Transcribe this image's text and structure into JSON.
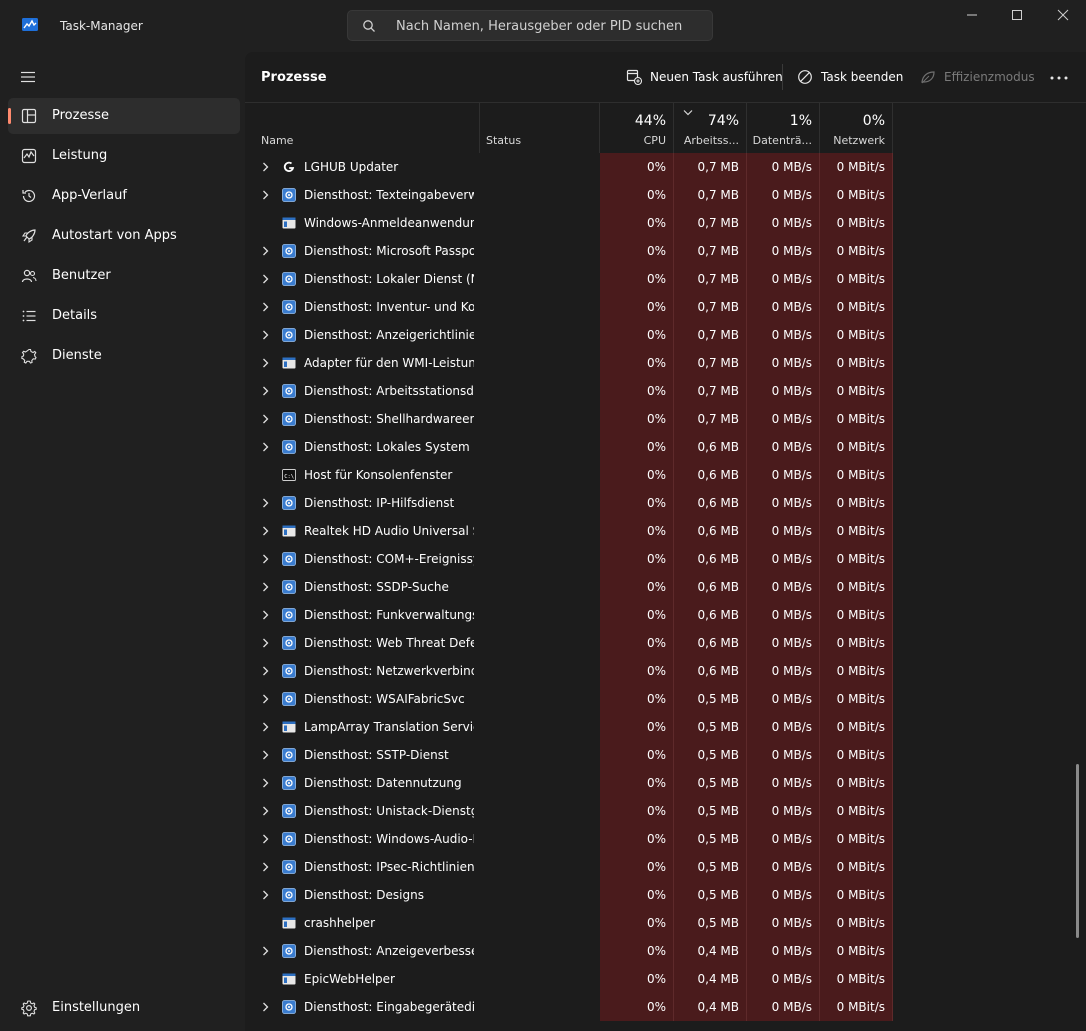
{
  "window": {
    "title": "Task-Manager",
    "search_placeholder": "Nach Namen, Herausgeber oder PID suchen"
  },
  "sidebar": {
    "items": [
      {
        "label": "Prozesse",
        "icon": "processes-icon",
        "active": true
      },
      {
        "label": "Leistung",
        "icon": "performance-icon"
      },
      {
        "label": "App-Verlauf",
        "icon": "history-icon"
      },
      {
        "label": "Autostart von Apps",
        "icon": "startup-icon"
      },
      {
        "label": "Benutzer",
        "icon": "users-icon"
      },
      {
        "label": "Details",
        "icon": "details-icon"
      },
      {
        "label": "Dienste",
        "icon": "services-icon"
      }
    ],
    "settings_label": "Einstellungen"
  },
  "toolbar": {
    "page_title": "Prozesse",
    "new_task_label": "Neuen Task ausführen",
    "end_task_label": "Task beenden",
    "efficiency_label": "Effizienzmodus"
  },
  "columns": {
    "name": "Name",
    "status": "Status",
    "cpu": {
      "label": "CPU",
      "percent": "44%"
    },
    "memory": {
      "label": "Arbeitss...",
      "percent": "74%"
    },
    "disk": {
      "label": "Datenträ...",
      "percent": "1%"
    },
    "network": {
      "label": "Netzwerk",
      "percent": "0%"
    }
  },
  "colors": {
    "heat": "#4a1b1c",
    "accent": "#ff8a6e"
  },
  "processes": [
    {
      "name": "LGHUB Updater",
      "icon": "logitech-icon",
      "expandable": true,
      "cpu": "0%",
      "memory": "0,7 MB",
      "disk": "0 MB/s",
      "network": "0 MBit/s"
    },
    {
      "name": "Diensthost: Texteingabeverwal...",
      "icon": "service-host-icon",
      "expandable": true,
      "cpu": "0%",
      "memory": "0,7 MB",
      "disk": "0 MB/s",
      "network": "0 MBit/s"
    },
    {
      "name": "Windows-Anmeldeanwendung",
      "icon": "app-window-icon",
      "expandable": false,
      "cpu": "0%",
      "memory": "0,7 MB",
      "disk": "0 MB/s",
      "network": "0 MBit/s"
    },
    {
      "name": "Diensthost: Microsoft Passport",
      "icon": "service-host-icon",
      "expandable": true,
      "cpu": "0%",
      "memory": "0,7 MB",
      "disk": "0 MB/s",
      "network": "0 MBit/s"
    },
    {
      "name": "Diensthost: Lokaler Dienst (Ne...",
      "icon": "service-host-icon",
      "expandable": true,
      "cpu": "0%",
      "memory": "0,7 MB",
      "disk": "0 MB/s",
      "network": "0 MBit/s"
    },
    {
      "name": "Diensthost: Inventur- und Ko...",
      "icon": "service-host-icon",
      "expandable": true,
      "cpu": "0%",
      "memory": "0,7 MB",
      "disk": "0 MB/s",
      "network": "0 MBit/s"
    },
    {
      "name": "Diensthost: Anzeigerichtlinien...",
      "icon": "service-host-icon",
      "expandable": true,
      "cpu": "0%",
      "memory": "0,7 MB",
      "disk": "0 MB/s",
      "network": "0 MBit/s"
    },
    {
      "name": "Adapter für den WMI-Leistun...",
      "icon": "app-window-icon",
      "expandable": true,
      "cpu": "0%",
      "memory": "0,7 MB",
      "disk": "0 MB/s",
      "network": "0 MBit/s"
    },
    {
      "name": "Diensthost: Arbeitsstationsdie...",
      "icon": "service-host-icon",
      "expandable": true,
      "cpu": "0%",
      "memory": "0,7 MB",
      "disk": "0 MB/s",
      "network": "0 MBit/s"
    },
    {
      "name": "Diensthost: Shellhardwareerke...",
      "icon": "service-host-icon",
      "expandable": true,
      "cpu": "0%",
      "memory": "0,7 MB",
      "disk": "0 MB/s",
      "network": "0 MBit/s"
    },
    {
      "name": "Diensthost: Lokales System",
      "icon": "service-host-icon",
      "expandable": true,
      "cpu": "0%",
      "memory": "0,6 MB",
      "disk": "0 MB/s",
      "network": "0 MBit/s"
    },
    {
      "name": "Host für Konsolenfenster",
      "icon": "console-icon",
      "expandable": false,
      "cpu": "0%",
      "memory": "0,6 MB",
      "disk": "0 MB/s",
      "network": "0 MBit/s"
    },
    {
      "name": "Diensthost: IP-Hilfsdienst",
      "icon": "service-host-icon",
      "expandable": true,
      "cpu": "0%",
      "memory": "0,6 MB",
      "disk": "0 MB/s",
      "network": "0 MBit/s"
    },
    {
      "name": "Realtek HD Audio Universal Se...",
      "icon": "app-window-icon",
      "expandable": true,
      "cpu": "0%",
      "memory": "0,6 MB",
      "disk": "0 MB/s",
      "network": "0 MBit/s"
    },
    {
      "name": "Diensthost: COM+-Ereignissys...",
      "icon": "service-host-icon",
      "expandable": true,
      "cpu": "0%",
      "memory": "0,6 MB",
      "disk": "0 MB/s",
      "network": "0 MBit/s"
    },
    {
      "name": "Diensthost: SSDP-Suche",
      "icon": "service-host-icon",
      "expandable": true,
      "cpu": "0%",
      "memory": "0,6 MB",
      "disk": "0 MB/s",
      "network": "0 MBit/s"
    },
    {
      "name": "Diensthost: Funkverwaltungsd...",
      "icon": "service-host-icon",
      "expandable": true,
      "cpu": "0%",
      "memory": "0,6 MB",
      "disk": "0 MB/s",
      "network": "0 MBit/s"
    },
    {
      "name": "Diensthost: Web Threat Defen...",
      "icon": "service-host-icon",
      "expandable": true,
      "cpu": "0%",
      "memory": "0,6 MB",
      "disk": "0 MB/s",
      "network": "0 MBit/s"
    },
    {
      "name": "Diensthost: Netzwerkverbindu...",
      "icon": "service-host-icon",
      "expandable": true,
      "cpu": "0%",
      "memory": "0,6 MB",
      "disk": "0 MB/s",
      "network": "0 MBit/s"
    },
    {
      "name": "Diensthost: WSAIFabricSvc",
      "icon": "service-host-icon",
      "expandable": true,
      "cpu": "0%",
      "memory": "0,5 MB",
      "disk": "0 MB/s",
      "network": "0 MBit/s"
    },
    {
      "name": "LampArray Translation Service",
      "icon": "app-window-icon",
      "expandable": true,
      "cpu": "0%",
      "memory": "0,5 MB",
      "disk": "0 MB/s",
      "network": "0 MBit/s"
    },
    {
      "name": "Diensthost: SSTP-Dienst",
      "icon": "service-host-icon",
      "expandable": true,
      "cpu": "0%",
      "memory": "0,5 MB",
      "disk": "0 MB/s",
      "network": "0 MBit/s"
    },
    {
      "name": "Diensthost: Datennutzung",
      "icon": "service-host-icon",
      "expandable": true,
      "cpu": "0%",
      "memory": "0,5 MB",
      "disk": "0 MB/s",
      "network": "0 MBit/s"
    },
    {
      "name": "Diensthost: Unistack-Dienstgr...",
      "icon": "service-host-icon",
      "expandable": true,
      "cpu": "0%",
      "memory": "0,5 MB",
      "disk": "0 MB/s",
      "network": "0 MBit/s"
    },
    {
      "name": "Diensthost: Windows-Audio-E...",
      "icon": "service-host-icon",
      "expandable": true,
      "cpu": "0%",
      "memory": "0,5 MB",
      "disk": "0 MB/s",
      "network": "0 MBit/s"
    },
    {
      "name": "Diensthost: IPsec-Richtlinien-...",
      "icon": "service-host-icon",
      "expandable": true,
      "cpu": "0%",
      "memory": "0,5 MB",
      "disk": "0 MB/s",
      "network": "0 MBit/s"
    },
    {
      "name": "Diensthost: Designs",
      "icon": "service-host-icon",
      "expandable": true,
      "cpu": "0%",
      "memory": "0,5 MB",
      "disk": "0 MB/s",
      "network": "0 MBit/s"
    },
    {
      "name": "crashhelper",
      "icon": "app-window-icon",
      "expandable": false,
      "cpu": "0%",
      "memory": "0,5 MB",
      "disk": "0 MB/s",
      "network": "0 MBit/s"
    },
    {
      "name": "Diensthost: Anzeigeverbesseru...",
      "icon": "service-host-icon",
      "expandable": true,
      "cpu": "0%",
      "memory": "0,4 MB",
      "disk": "0 MB/s",
      "network": "0 MBit/s"
    },
    {
      "name": "EpicWebHelper",
      "icon": "app-window-icon",
      "expandable": false,
      "cpu": "0%",
      "memory": "0,4 MB",
      "disk": "0 MB/s",
      "network": "0 MBit/s"
    },
    {
      "name": "Diensthost: Eingabegerätedienst",
      "icon": "service-host-icon",
      "expandable": true,
      "cpu": "0%",
      "memory": "0,4 MB",
      "disk": "0 MB/s",
      "network": "0 MBit/s"
    }
  ]
}
